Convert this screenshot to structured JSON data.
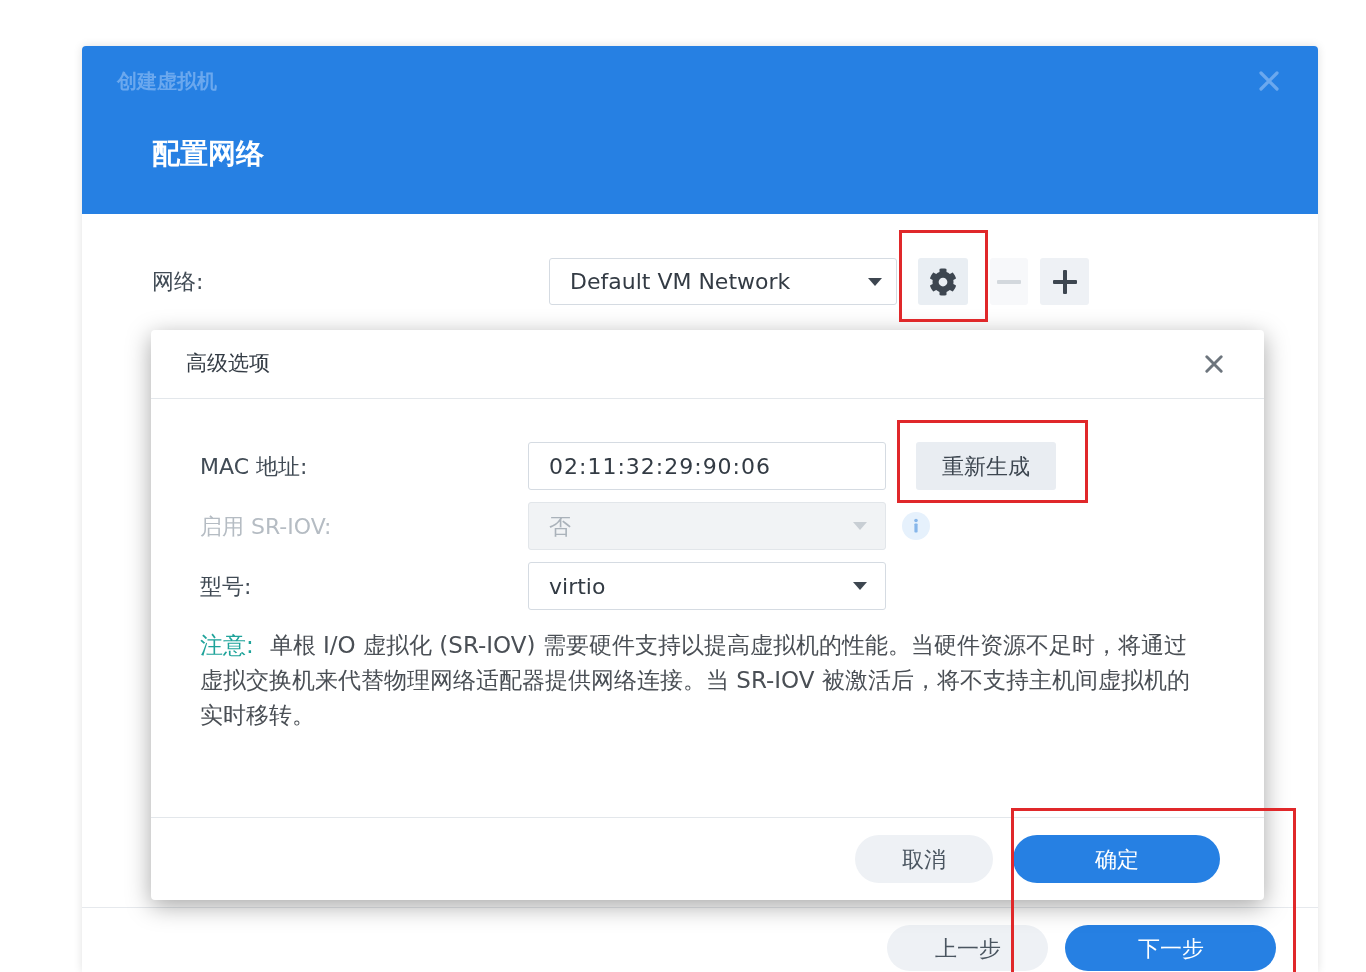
{
  "dialog": {
    "title": "创建虚拟机",
    "step_title": "配置网络",
    "network": {
      "label": "网络:",
      "value": "Default VM Network",
      "settings_button": {
        "highlighted": true
      },
      "remove_button": {
        "disabled": true
      },
      "add_button": {
        "disabled": false
      }
    },
    "footer_buttons": [
      {
        "label": "上一步",
        "kind": "secondary"
      },
      {
        "label": "下一步",
        "kind": "primary"
      }
    ]
  },
  "advanced_options": {
    "title": "高级选项",
    "fields": [
      {
        "kind": "input",
        "label": "MAC 地址:",
        "value": "02:11:32:29:90:06",
        "disabled": false,
        "action": {
          "label": "重新生成",
          "highlighted": true
        }
      },
      {
        "kind": "select",
        "label": "启用 SR-IOV:",
        "value": "否",
        "disabled": true,
        "has_info": true
      },
      {
        "kind": "select",
        "label": "型号:",
        "value": "virtio",
        "disabled": false
      }
    ],
    "note": {
      "label": "注意:",
      "text": "单根 I/O 虚拟化 (SR-IOV) 需要硬件支持以提高虚拟机的性能。当硬件资源不足时，将通过虚拟交换机来代替物理网络适配器提供网络连接。当 SR-IOV 被激活后，将不支持主机间虚拟机的实时移转。"
    },
    "buttons": [
      {
        "label": "取消",
        "kind": "secondary",
        "highlighted": false
      },
      {
        "label": "确定",
        "kind": "primary",
        "highlighted": true
      }
    ]
  }
}
